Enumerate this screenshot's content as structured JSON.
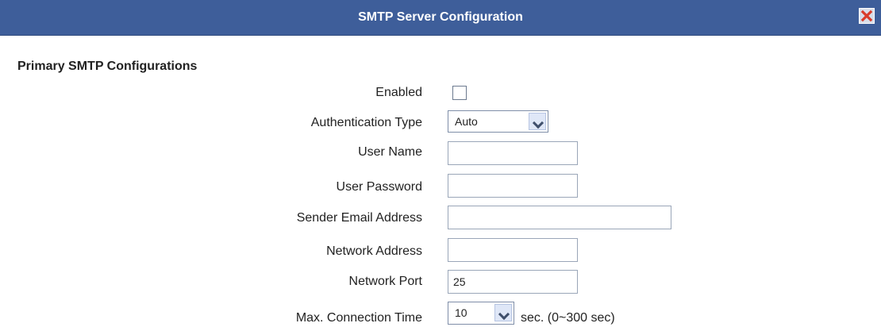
{
  "dialog": {
    "title": "SMTP Server Configuration",
    "close_icon": "close-icon"
  },
  "section": {
    "title": "Primary SMTP Configurations"
  },
  "fields": {
    "enabled": {
      "label": "Enabled",
      "checked": false
    },
    "authentication_type": {
      "label": "Authentication Type",
      "value": "Auto"
    },
    "user_name": {
      "label": "User Name",
      "value": ""
    },
    "user_password": {
      "label": "User Password",
      "value": ""
    },
    "sender_email": {
      "label": "Sender Email Address",
      "value": ""
    },
    "network_address": {
      "label": "Network Address",
      "value": ""
    },
    "network_port": {
      "label": "Network Port",
      "value": "25"
    },
    "max_connection_time": {
      "label": "Max. Connection Time",
      "value": "10",
      "suffix": "sec. (0~300 sec)"
    }
  },
  "colors": {
    "titlebar": "#3e5e9a",
    "close": "#d93b2a"
  }
}
